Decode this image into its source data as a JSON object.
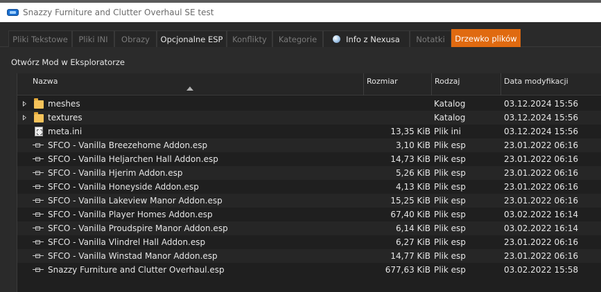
{
  "window": {
    "title": "Snazzy Furniture and Clutter Overhaul SE test"
  },
  "tabs": [
    {
      "label": "Pliki Tekstowe",
      "enabled": false,
      "active": false
    },
    {
      "label": "Pliki INI",
      "enabled": false,
      "active": false
    },
    {
      "label": "Obrazy",
      "enabled": false,
      "active": false
    },
    {
      "label": "Opcjonalne ESP",
      "enabled": true,
      "active": false
    },
    {
      "label": "Konflikty",
      "enabled": false,
      "active": false
    },
    {
      "label": "Kategorie",
      "enabled": false,
      "active": false
    },
    {
      "label": "Info z Nexusa",
      "enabled": true,
      "active": false,
      "icon": "globe-icon"
    },
    {
      "label": "Notatki",
      "enabled": false,
      "active": false
    },
    {
      "label": "Drzewko plików",
      "enabled": true,
      "active": true
    }
  ],
  "toolbar": {
    "open_label": "Otwórz Mod w Eksploratorze"
  },
  "tree": {
    "columns": {
      "name": "Nazwa",
      "size": "Rozmiar",
      "type": "Rodzaj",
      "date": "Data modyfikacji"
    },
    "sort_column": "name",
    "rows": [
      {
        "icon": "folder-icon",
        "expandable": true,
        "name": "meshes",
        "size": "",
        "type": "Katalog",
        "date": "03.12.2024 15:56"
      },
      {
        "icon": "folder-icon",
        "expandable": true,
        "name": "textures",
        "size": "",
        "type": "Katalog",
        "date": "03.12.2024 15:56"
      },
      {
        "icon": "ini-file-icon",
        "expandable": false,
        "name": "meta.ini",
        "size": "13,35 KiB",
        "type": "Plik ini",
        "date": "03.12.2024 15:56"
      },
      {
        "icon": "plugin-file-icon",
        "expandable": false,
        "name": "SFCO - Vanilla Breezehome Addon.esp",
        "size": "3,10 KiB",
        "type": "Plik esp",
        "date": "23.01.2022 06:16"
      },
      {
        "icon": "plugin-file-icon",
        "expandable": false,
        "name": "SFCO - Vanilla Heljarchen Hall Addon.esp",
        "size": "14,73 KiB",
        "type": "Plik esp",
        "date": "23.01.2022 06:16"
      },
      {
        "icon": "plugin-file-icon",
        "expandable": false,
        "name": "SFCO - Vanilla Hjerim Addon.esp",
        "size": "5,26 KiB",
        "type": "Plik esp",
        "date": "23.01.2022 06:16"
      },
      {
        "icon": "plugin-file-icon",
        "expandable": false,
        "name": "SFCO - Vanilla Honeyside Addon.esp",
        "size": "4,13 KiB",
        "type": "Plik esp",
        "date": "23.01.2022 06:16"
      },
      {
        "icon": "plugin-file-icon",
        "expandable": false,
        "name": "SFCO - Vanilla Lakeview Manor Addon.esp",
        "size": "15,25 KiB",
        "type": "Plik esp",
        "date": "23.01.2022 06:16"
      },
      {
        "icon": "plugin-file-icon",
        "expandable": false,
        "name": "SFCO - Vanilla Player Homes Addon.esp",
        "size": "67,40 KiB",
        "type": "Plik esp",
        "date": "03.02.2022 16:14"
      },
      {
        "icon": "plugin-file-icon",
        "expandable": false,
        "name": "SFCO - Vanilla Proudspire Manor Addon.esp",
        "size": "6,14 KiB",
        "type": "Plik esp",
        "date": "03.02.2022 16:14"
      },
      {
        "icon": "plugin-file-icon",
        "expandable": false,
        "name": "SFCO - Vanilla Vlindrel Hall Addon.esp",
        "size": "6,27 KiB",
        "type": "Plik esp",
        "date": "23.01.2022 06:16"
      },
      {
        "icon": "plugin-file-icon",
        "expandable": false,
        "name": "SFCO - Vanilla Winstad Manor Addon.esp",
        "size": "14,77 KiB",
        "type": "Plik esp",
        "date": "23.01.2022 06:16"
      },
      {
        "icon": "plugin-file-icon",
        "expandable": false,
        "name": "Snazzy Furniture and Clutter Overhaul.esp",
        "size": "677,63 KiB",
        "type": "Plik esp",
        "date": "03.02.2022 15:58"
      }
    ]
  },
  "colors": {
    "accent": "#e06a10",
    "background": "#1f1f1f",
    "text": "#e6e6e6",
    "disabled_text": "#7a7a7a"
  }
}
